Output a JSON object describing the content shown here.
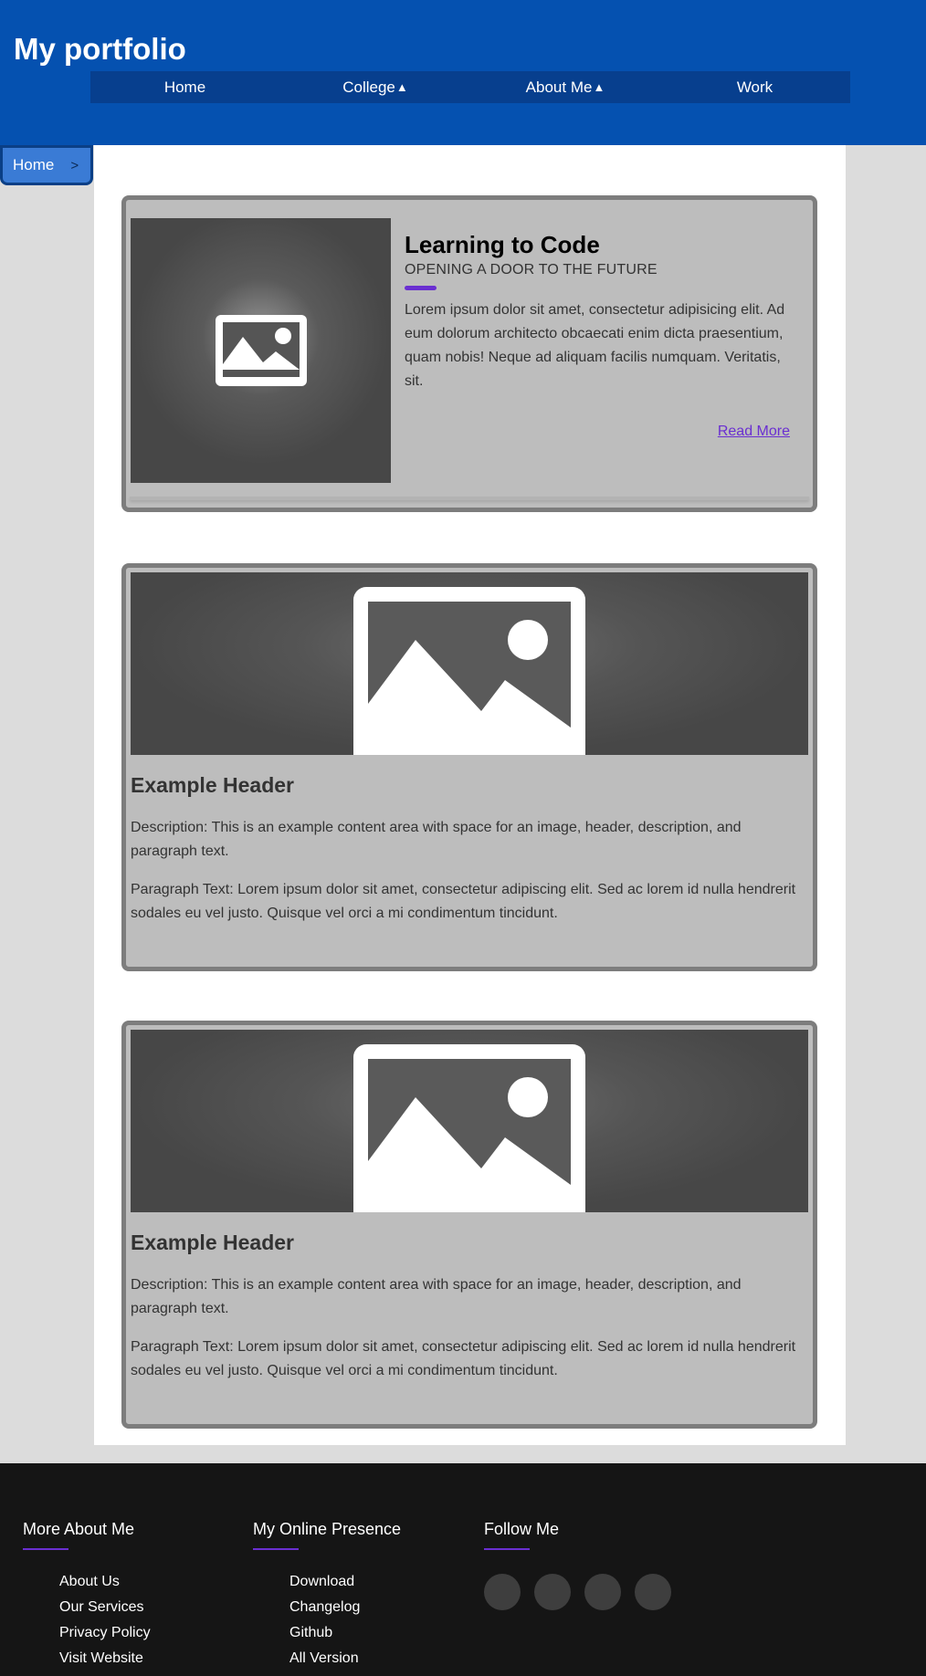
{
  "header": {
    "site_title": "My portfolio",
    "nav": [
      {
        "label": "Home",
        "caret": ""
      },
      {
        "label": "College",
        "caret": "▲"
      },
      {
        "label": "About Me",
        "caret": "▲"
      },
      {
        "label": "Work",
        "caret": ""
      }
    ]
  },
  "breadcrumb": {
    "label": "Home",
    "separator": ">"
  },
  "featured": {
    "image_icon": "image-placeholder-icon",
    "title": "Learning to Code",
    "subtitle": "OPENING A DOOR TO THE FUTURE",
    "body": "Lorem ipsum dolor sit amet, consectetur adipisicing elit. Ad eum dolorum architecto obcaecati enim dicta praesentium, quam nobis! Neque ad aliquam facilis numquam. Veritatis, sit.",
    "read_more": "Read More"
  },
  "cards": [
    {
      "image_icon": "image-placeholder-icon",
      "header": "Example Header",
      "description": "Description: This is an example content area with space for an image, header, description, and paragraph text.",
      "paragraph": "Paragraph Text: Lorem ipsum dolor sit amet, consectetur adipiscing elit. Sed ac lorem id nulla hendrerit sodales eu vel justo. Quisque vel orci a mi condimentum tincidunt."
    },
    {
      "image_icon": "image-placeholder-icon",
      "header": "Example Header",
      "description": "Description: This is an example content area with space for an image, header, description, and paragraph text.",
      "paragraph": "Paragraph Text: Lorem ipsum dolor sit amet, consectetur adipiscing elit. Sed ac lorem id nulla hendrerit sodales eu vel justo. Quisque vel orci a mi condimentum tincidunt."
    }
  ],
  "footer": {
    "columns": [
      {
        "title": "More About Me",
        "links": [
          "About Us",
          "Our Services",
          "Privacy Policy",
          "Visit Website"
        ]
      },
      {
        "title": "My Online Presence",
        "links": [
          "Download",
          "Changelog",
          "Github",
          "All Version"
        ]
      },
      {
        "title": "Follow Me",
        "social_icons": [
          "social-icon-1",
          "social-icon-2",
          "social-icon-3",
          "social-icon-4"
        ]
      }
    ]
  },
  "colors": {
    "header_blue": "#0551b0",
    "nav_blue": "#073f8e",
    "accent_purple": "#6a2fd1",
    "card_gray": "#bdbdbd",
    "footer_black": "#151515"
  }
}
